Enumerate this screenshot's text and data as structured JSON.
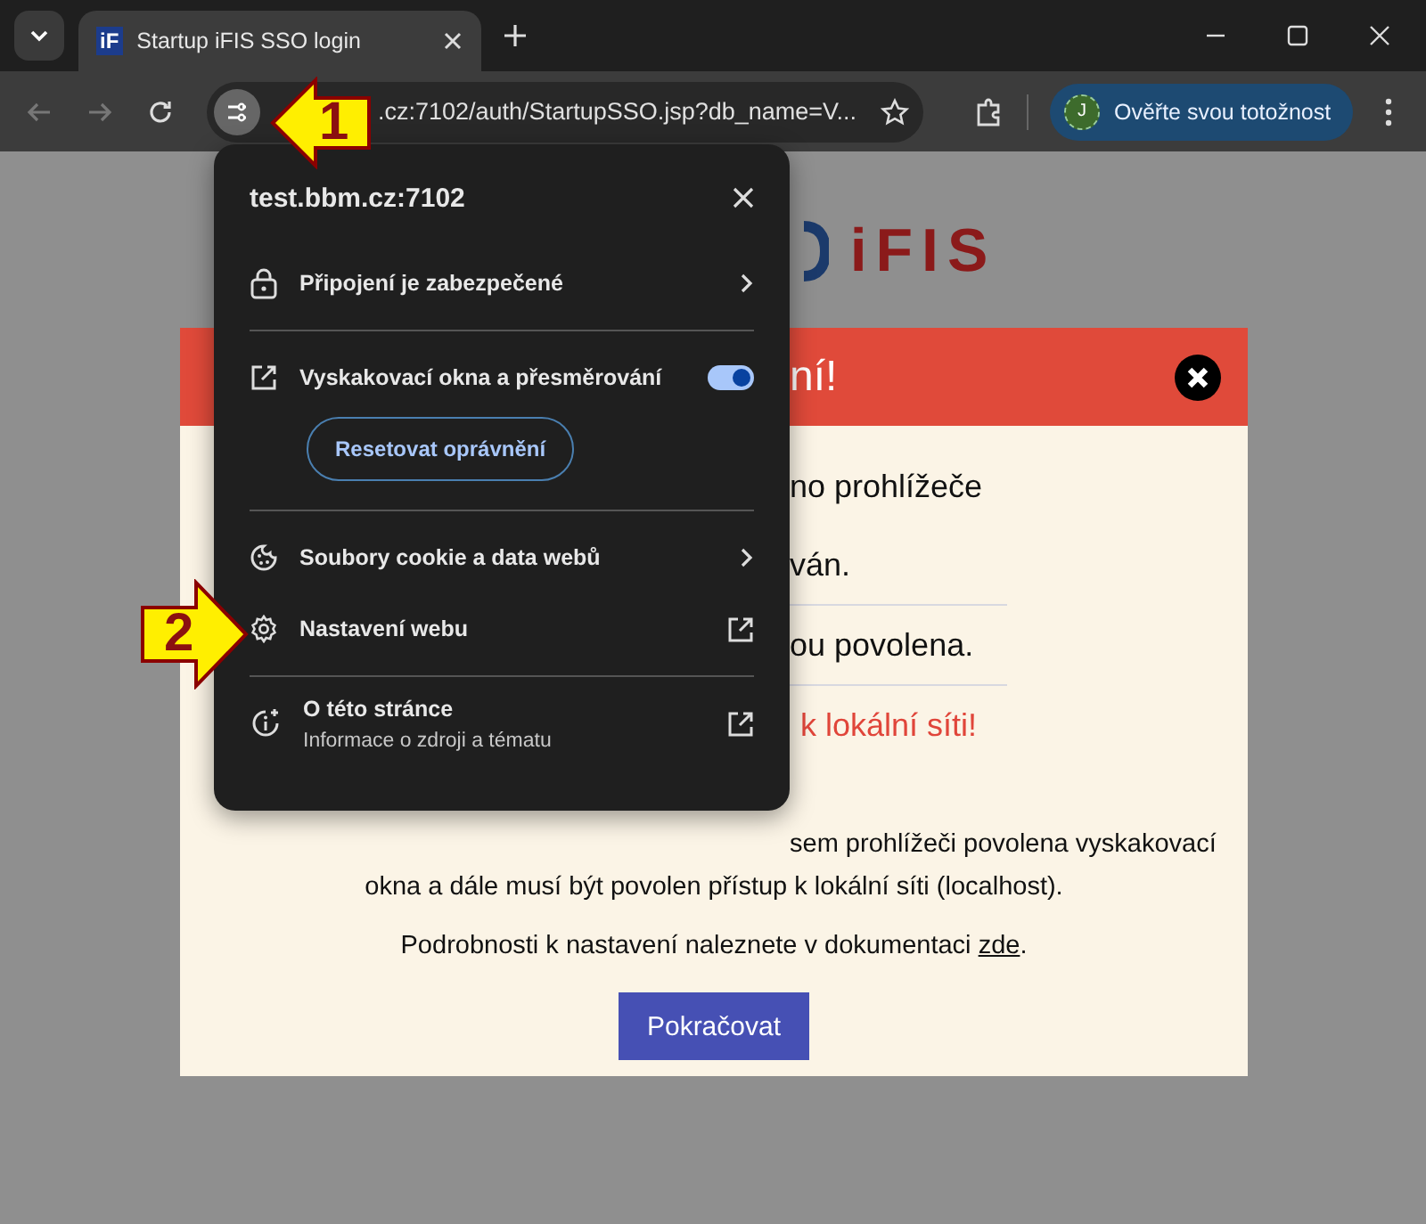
{
  "browser": {
    "tab_title": "Startup iFIS SSO login",
    "tab_icon": "iF",
    "url": ".cz:7102/auth/StartupSSO.jsp?db_name=V...",
    "profile_label": "Ověřte svou totožnost",
    "avatar": "J"
  },
  "popup": {
    "host": "test.bbm.cz:7102",
    "groups": [
      [
        {
          "kind": "nav",
          "label": "Připojení je zabezpečené"
        }
      ],
      [
        {
          "kind": "toggle",
          "label": "Vyskakovací okna a přesměrování",
          "on": true
        },
        {
          "kind": "button",
          "label": "Resetovat oprávnění"
        }
      ],
      [
        {
          "kind": "nav",
          "label": "Soubory cookie a data webů"
        },
        {
          "kind": "external",
          "label": "Nastavení webu"
        }
      ],
      [
        {
          "kind": "external",
          "label": "O této stránce",
          "sub": "Informace o zdroji a tématu"
        }
      ]
    ]
  },
  "page": {
    "logo": "iFIS",
    "header": "ní!",
    "rows": [
      {
        "kind": "text",
        "text": "no prohlížeče"
      },
      {
        "kind": "text",
        "text": "ván."
      },
      {
        "kind": "divider"
      },
      {
        "kind": "text",
        "text": "ou povolena."
      },
      {
        "kind": "divider"
      },
      {
        "kind": "warning",
        "text": "k lokální síti!"
      }
    ],
    "para": [
      "sem prohlížeči povolena vyskakovací",
      "okna a dále musí být povolen přístup k lokální síti (localhost)."
    ],
    "details": "Podrobnosti k nastavení naleznete v dokumentaci",
    "link": "zde",
    "after_link": ".",
    "button": "Pokračovat"
  },
  "callouts": [
    "1",
    "2"
  ]
}
